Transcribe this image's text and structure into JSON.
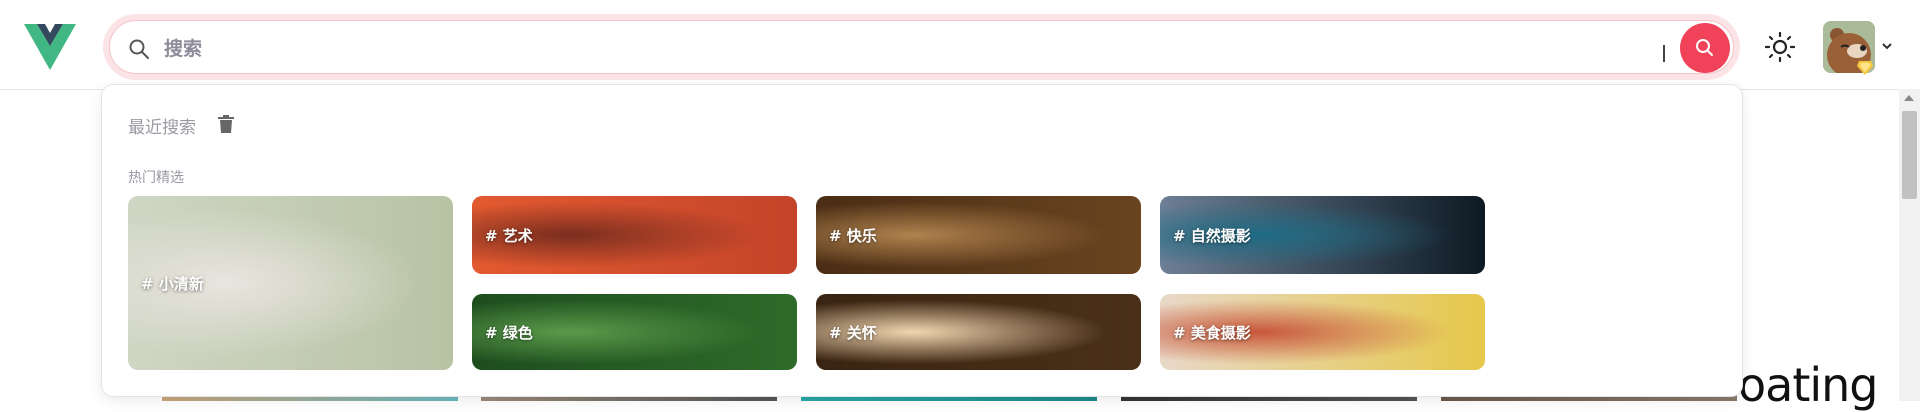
{
  "search": {
    "placeholder": "搜索"
  },
  "dropdown": {
    "recent_title": "最近搜索",
    "hot_title": "热门精选",
    "tags": [
      {
        "label": "# 小清新",
        "colors": [
          "#cfd6c4",
          "#e9e4df",
          "#b8c3a4"
        ]
      },
      {
        "label": "# 艺术",
        "colors": [
          "#e35a30",
          "#7a2e1f",
          "#c4442a"
        ]
      },
      {
        "label": "# 快乐",
        "colors": [
          "#4a2d14",
          "#b0824e",
          "#6a4420"
        ]
      },
      {
        "label": "# 自然摄影",
        "colors": [
          "#6d7f95",
          "#1f6c85",
          "#0d1a24"
        ]
      },
      {
        "label": "# 绿色",
        "colors": [
          "#1e4d1e",
          "#5b9a4a",
          "#2e6b2a"
        ]
      },
      {
        "label": "# 关怀",
        "colors": [
          "#3a2412",
          "#f1d6b0",
          "#4a3018"
        ]
      },
      {
        "label": "# 美食摄影",
        "colors": [
          "#e8d8c8",
          "#c8563a",
          "#e6c84a"
        ]
      }
    ]
  },
  "background": {
    "partial_text": "oating"
  },
  "colors": {
    "accent": "#f0435a",
    "logo_green": "#41b883",
    "logo_dark": "#35495e"
  }
}
